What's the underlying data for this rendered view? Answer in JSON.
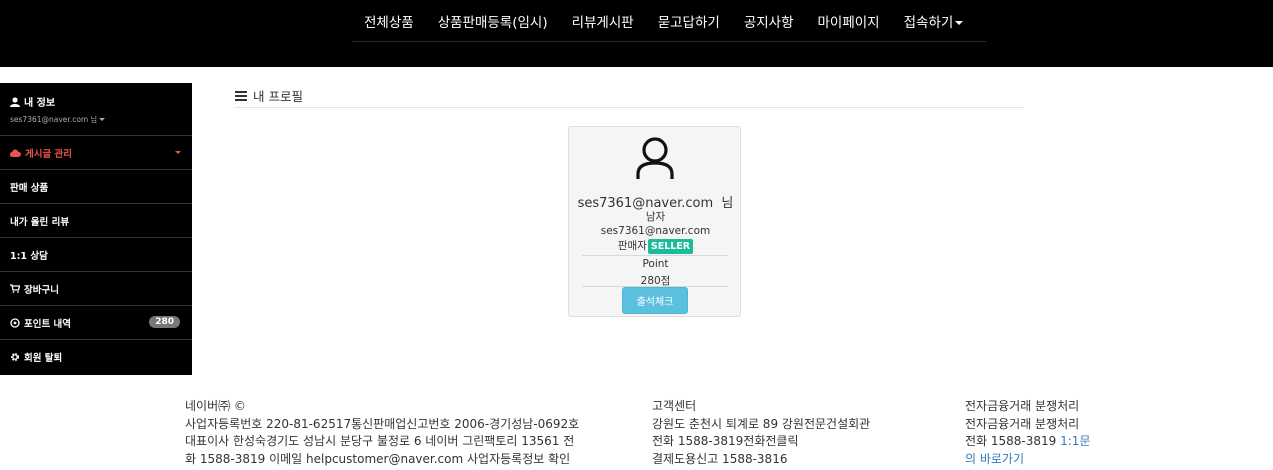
{
  "nav": {
    "items": [
      "전체상품",
      "상품판매등록(임시)",
      "리뷰게시판",
      "묻고답하기",
      "공지사항",
      "마이페이지"
    ],
    "login_label": "접속하기"
  },
  "sidebar": {
    "profile": {
      "title": "내 정보",
      "email": "ses7361@naver.com",
      "suffix": "님"
    },
    "items": [
      {
        "label": "게시글 관리",
        "icon": "cloud-icon",
        "active": true
      },
      {
        "label": "판매 상품"
      },
      {
        "label": "내가 올린 리뷰"
      },
      {
        "label": "1:1 상담"
      },
      {
        "label": "장바구니",
        "icon": "cart-icon"
      },
      {
        "label": "포인트 내역",
        "icon": "points-icon",
        "badge": "280"
      },
      {
        "label": "회원 탈퇴",
        "icon": "gear-icon"
      }
    ],
    "active_color": "#e8534a"
  },
  "main": {
    "header": "내 프로필",
    "card": {
      "name": "ses7361@naver.com  님",
      "gender": "남자",
      "email": "ses7361@naver.com",
      "role": "판매자",
      "role_badge": "SELLER",
      "point_label": "Point",
      "point_value": "280점",
      "check_button": "출석체크"
    }
  },
  "footer": {
    "col1": [
      "네이버㈜ ©",
      "사업자등록번호 220-81-62517통신판매업신고번호 2006-경기성남-0692호",
      "대표이사 한성숙경기도 성남시 분당구 불정로 6 네이버 그린팩토리 13561 전",
      "화 1588-3819 이메일 helpcustomer@naver.com 사업자등록정보 확인"
    ],
    "col2": [
      "고객센터",
      "강원도 춘천시 퇴계로 89 강원전문건설회관",
      "전화 1588-3819전화전클릭",
      "결제도용신고 1588-3816"
    ],
    "col3": {
      "line1": "전자금융거래 분쟁처리",
      "line2": "전자금융거래 분쟁처리",
      "line3_prefix": "전화 1588-3819 ",
      "line3_link": "1:1문",
      "line4_link": "의 바로가기"
    }
  },
  "colors": {
    "seller_badge": "#1abc9c",
    "check_button": "#5bc0de",
    "link": "#337ab7"
  }
}
